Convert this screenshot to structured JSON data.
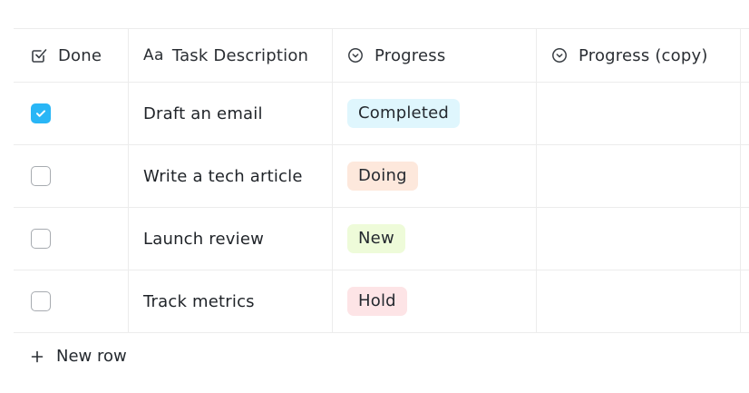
{
  "headers": {
    "done": "Done",
    "task_prefix": "Aa",
    "task": "Task Description",
    "progress": "Progress",
    "progress_copy": "Progress (copy)"
  },
  "rows": [
    {
      "done": true,
      "task": "Draft an email",
      "progress": "Completed",
      "progress_color": "#dff6fd"
    },
    {
      "done": false,
      "task": "Write a tech article",
      "progress": "Doing",
      "progress_color": "#fde8dc"
    },
    {
      "done": false,
      "task": "Launch review",
      "progress": "New",
      "progress_color": "#eefbd9"
    },
    {
      "done": false,
      "task": "Track metrics",
      "progress": "Hold",
      "progress_color": "#fde4e6"
    }
  ],
  "new_row_label": "New row",
  "icons": {
    "done_header": "checkbox-header-icon",
    "progress_header": "select-chevron-icon",
    "check": "checkmark-icon",
    "plus": "plus-icon"
  },
  "colors": {
    "checkbox_checked": "#29b6f6",
    "border": "#ececec"
  }
}
